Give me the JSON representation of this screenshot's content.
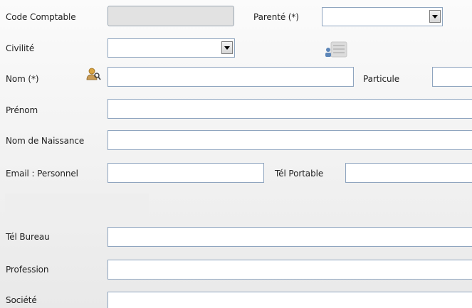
{
  "form": {
    "code_comptable": {
      "label": "Code Comptable",
      "value": ""
    },
    "parente": {
      "label": "Parenté (*)",
      "selected": ""
    },
    "civilite": {
      "label": "Civilité",
      "selected": ""
    },
    "nom": {
      "label": "Nom (*)",
      "value": ""
    },
    "particule": {
      "label": "Particule",
      "value": ""
    },
    "prenom": {
      "label": "Prénom",
      "value": ""
    },
    "nom_naissance": {
      "label": "Nom de Naissance",
      "value": ""
    },
    "email_personnel": {
      "label": "Email : Personnel",
      "value": ""
    },
    "tel_portable": {
      "label": "Tél Portable",
      "value": ""
    },
    "tel_bureau": {
      "label": "Tél Bureau",
      "value": ""
    },
    "profession": {
      "label": "Profession",
      "value": ""
    },
    "societe": {
      "label": "Société",
      "value": ""
    }
  },
  "icons": {
    "search_person": "person-search-icon",
    "contact_card": "contact-card-icon"
  },
  "colors": {
    "input_border": "#8fa5bf",
    "readonly_bg": "#e2e2e2"
  }
}
